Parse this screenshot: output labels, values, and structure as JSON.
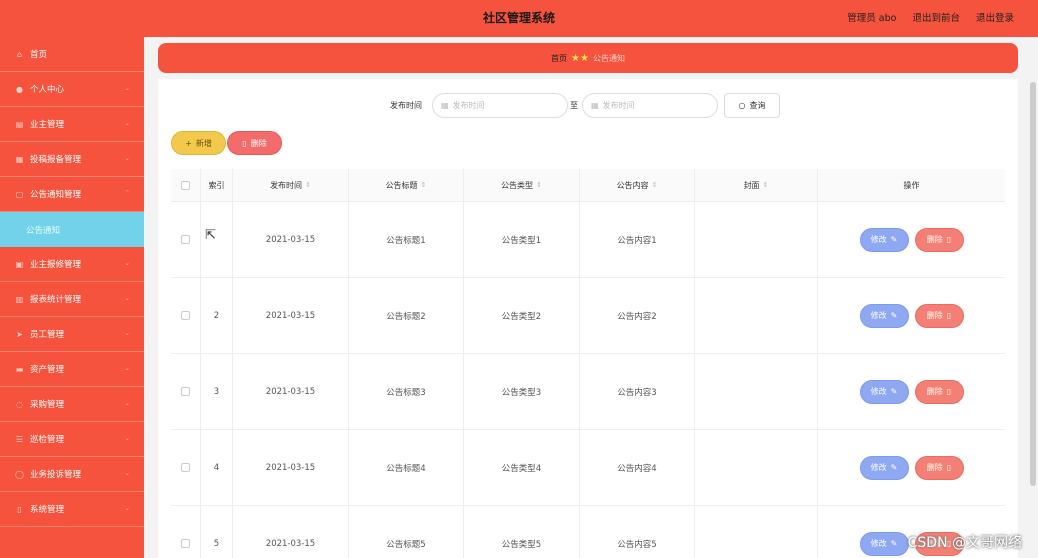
{
  "header": {
    "title": "社区管理系统",
    "admin_label": "管理员 abo",
    "front_link": "退出到前台",
    "logout_link": "退出登录"
  },
  "sidebar": {
    "items": [
      {
        "label": "首页",
        "icon": "home-icon"
      },
      {
        "label": "个人中心",
        "icon": "user-icon"
      },
      {
        "label": "业主管理",
        "icon": "building-icon"
      },
      {
        "label": "投稿报备管理",
        "icon": "grid-icon"
      },
      {
        "label": "公告通知管理",
        "icon": "notice-icon"
      },
      {
        "label": "公告通知",
        "icon": ""
      },
      {
        "label": "业主报修管理",
        "icon": "wrench-icon"
      },
      {
        "label": "报表统计管理",
        "icon": "chart-icon"
      },
      {
        "label": "员工管理",
        "icon": "send-icon"
      },
      {
        "label": "资产管理",
        "icon": "asset-icon"
      },
      {
        "label": "采购管理",
        "icon": "cart-icon"
      },
      {
        "label": "巡检管理",
        "icon": "list-icon"
      },
      {
        "label": "业务投诉管理",
        "icon": "complaint-icon"
      },
      {
        "label": "系统管理",
        "icon": "settings-icon"
      }
    ]
  },
  "breadcrumb": {
    "home": "首页",
    "current": "公告通知"
  },
  "search": {
    "label": "发布时间",
    "start_placeholder": "发布时间",
    "to": "至",
    "end_placeholder": "发布时间",
    "button": "查询"
  },
  "actions": {
    "add": "新增",
    "delete": "删除"
  },
  "table": {
    "columns": [
      "索引",
      "发布时间",
      "公告标题",
      "公告类型",
      "公告内容",
      "封面",
      "操作"
    ],
    "rows": [
      {
        "index": "",
        "date": "2021-03-15",
        "title": "公告标题1",
        "type": "公告类型1",
        "content": "公告内容1"
      },
      {
        "index": "2",
        "date": "2021-03-15",
        "title": "公告标题2",
        "type": "公告类型2",
        "content": "公告内容2"
      },
      {
        "index": "3",
        "date": "2021-03-15",
        "title": "公告标题3",
        "type": "公告类型3",
        "content": "公告内容3"
      },
      {
        "index": "4",
        "date": "2021-03-15",
        "title": "公告标题4",
        "type": "公告类型4",
        "content": "公告内容4"
      },
      {
        "index": "5",
        "date": "2021-03-15",
        "title": "公告标题5",
        "type": "公告类型5",
        "content": "公告内容5"
      }
    ],
    "edit_label": "修改",
    "remove_label": "删除"
  },
  "watermark": "CSDN @文哥网络",
  "colors": {
    "brand": "#f5533d",
    "active_submenu": "#72d2ea",
    "edit": "#8fa8f2",
    "remove": "#f47f76",
    "add": "#f2c94c"
  }
}
